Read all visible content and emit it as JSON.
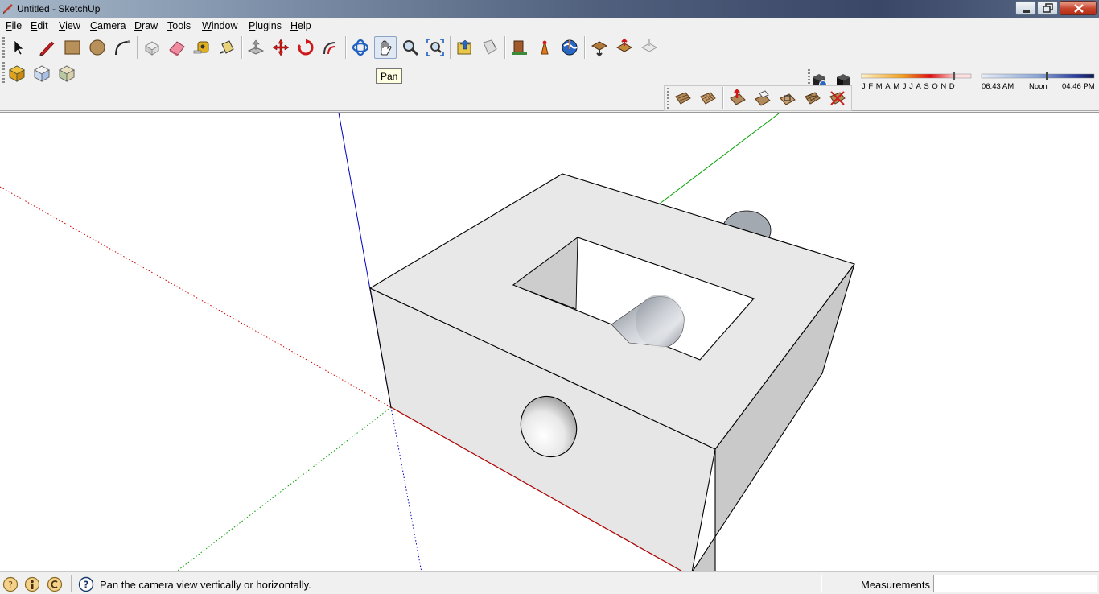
{
  "window": {
    "title": "Untitled - SketchUp"
  },
  "menu": [
    {
      "first": "F",
      "rest": "ile"
    },
    {
      "first": "E",
      "rest": "dit"
    },
    {
      "first": "V",
      "rest": "iew"
    },
    {
      "first": "C",
      "rest": "amera"
    },
    {
      "first": "D",
      "rest": "raw"
    },
    {
      "first": "T",
      "rest": "ools"
    },
    {
      "first": "W",
      "rest": "indow"
    },
    {
      "first": "P",
      "rest": "lugins"
    },
    {
      "first": "H",
      "rest": "elp"
    }
  ],
  "tooltip": {
    "text": "Pan"
  },
  "shadow": {
    "months": [
      "J",
      "F",
      "M",
      "A",
      "M",
      "J",
      "J",
      "A",
      "S",
      "O",
      "N",
      "D"
    ],
    "time_start": "06:43 AM",
    "time_mid": "Noon",
    "time_end": "04:46 PM"
  },
  "status": {
    "message": "Pan the camera view vertically or horizontally.",
    "measurements_label": "Measurements",
    "measurements_value": ""
  },
  "colors": {
    "axis_red": "#d00000",
    "axis_green": "#00a000",
    "axis_blue": "#0000c0",
    "face": "#e8e8e8"
  }
}
